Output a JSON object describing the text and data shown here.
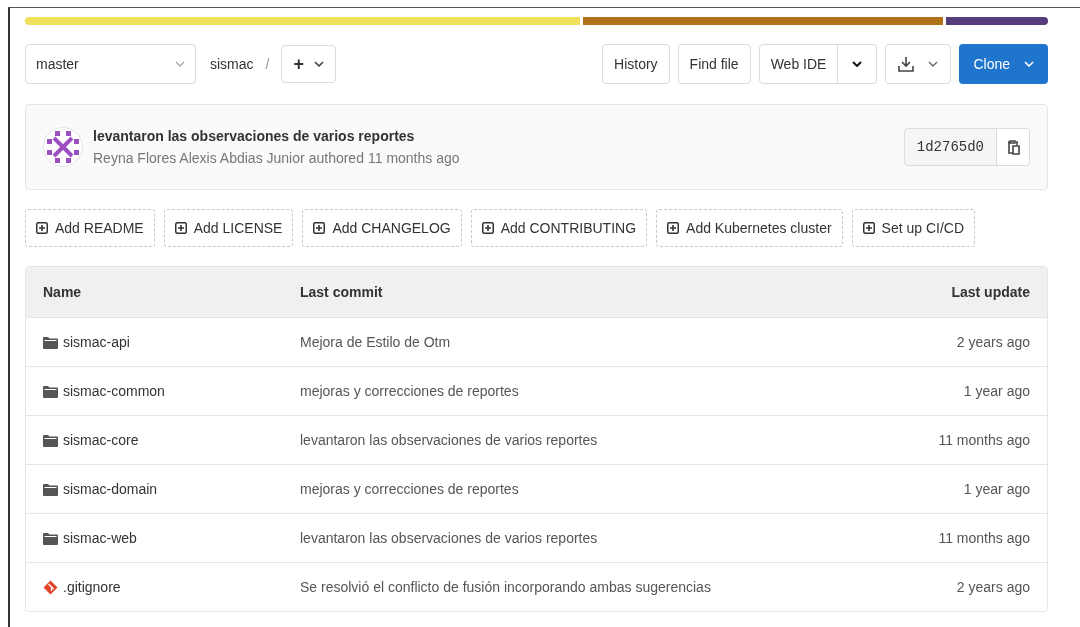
{
  "language_bar": [
    {
      "color": "#f1e05a"
    },
    {
      "color": "#b07219"
    },
    {
      "color": "#563d7c"
    }
  ],
  "branch_select": {
    "value": "master"
  },
  "breadcrumb": {
    "project": "sismac",
    "separator": "/",
    "add": "+"
  },
  "actions": [
    "History",
    "Find file"
  ],
  "web_ide": "Web IDE",
  "clone": "Clone",
  "last_commit": {
    "message": "levantaron las observaciones de varios reportes",
    "author": "Reyna Flores Alexis Abdias Junior",
    "verb": "authored",
    "time": "11 months ago",
    "sha": "1d2765d0"
  },
  "quick_actions": [
    "Add README",
    "Add LICENSE",
    "Add CHANGELOG",
    "Add CONTRIBUTING",
    "Add Kubernetes cluster",
    "Set up CI/CD"
  ],
  "table": {
    "columns": [
      "Name",
      "Last commit",
      "Last update"
    ],
    "rows": [
      {
        "kind": "folder",
        "name": "sismac-api",
        "commit": "Mejora de Estilo de Otm",
        "updated": "2 years ago"
      },
      {
        "kind": "folder",
        "name": "sismac-common",
        "commit": "mejoras y correcciones de reportes",
        "updated": "1 year ago"
      },
      {
        "kind": "folder",
        "name": "sismac-core",
        "commit": "levantaron las observaciones de varios reportes",
        "updated": "11 months ago"
      },
      {
        "kind": "folder",
        "name": "sismac-domain",
        "commit": "mejoras y correcciones de reportes",
        "updated": "1 year ago"
      },
      {
        "kind": "folder",
        "name": "sismac-web",
        "commit": "levantaron las observaciones de varios reportes",
        "updated": "11 months ago"
      },
      {
        "kind": "gitfile",
        "name": ".gitignore",
        "commit": "Se resolvió el conflicto de fusión incorporando ambas sugerencias",
        "updated": "2 years ago"
      }
    ]
  }
}
